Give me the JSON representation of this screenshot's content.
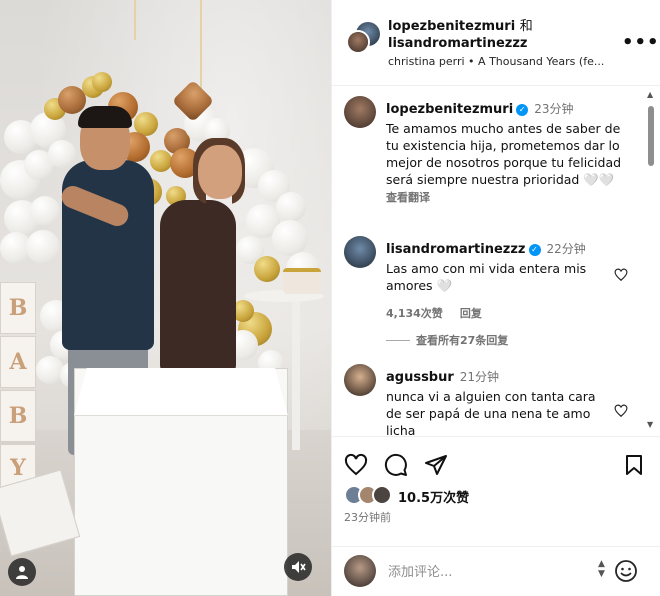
{
  "post": {
    "header": {
      "author1": "lopezbenitezmuri",
      "joiner": "和",
      "author2": "lisandromartinezzz",
      "audio": "christina perri • A Thousand Years (fe...",
      "more_label": "•••"
    },
    "comments": [
      {
        "user": "lopezbenitezmuri",
        "verified": true,
        "time": "23分钟",
        "text": "Te amamos mucho antes de saber de tu existencia hija, prometemos dar lo mejor de nosotros porque tu felicidad será siempre nuestra prioridad 🤍🤍",
        "translate": "查看翻译"
      },
      {
        "user": "lisandromartinezzz",
        "verified": true,
        "time": "22分钟",
        "text": "Las amo con mi vida entera mis amores 🤍",
        "likes": "4,134次赞",
        "reply": "回复",
        "view_replies": "查看所有27条回复"
      },
      {
        "user": "agussbur",
        "verified": false,
        "time": "21分钟",
        "text": "nunca vi a alguien con tanta cara de ser papá de una nena te amo licha"
      }
    ],
    "likes": "10.5万次赞",
    "posted": "23分钟前",
    "add_comment_placeholder": "添加评论...",
    "media": {
      "box_letters": [
        "B",
        "A",
        "B",
        "Y"
      ],
      "mute_icon": "speaker-muted-icon",
      "tag_icon": "person-icon"
    },
    "colors": {
      "verified": "#0095f6",
      "muted_text": "#737373"
    }
  }
}
